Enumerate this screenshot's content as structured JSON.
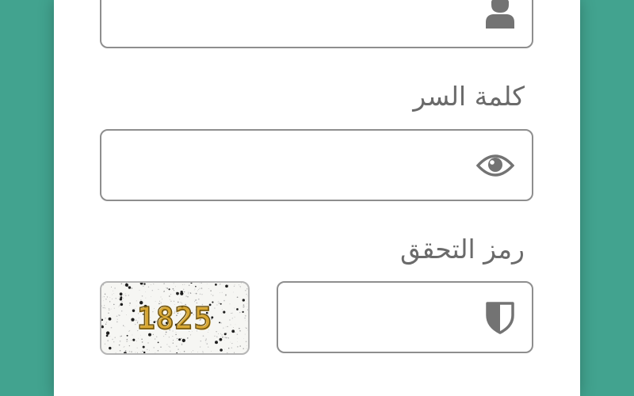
{
  "form": {
    "username": {
      "value": "",
      "icon": "user-icon"
    },
    "password": {
      "label": "كلمة السر",
      "value": "",
      "icon": "eye-icon"
    },
    "captcha": {
      "label": "رمز التحقق",
      "value": "",
      "icon": "shield-icon",
      "image_text": "1825"
    }
  },
  "colors": {
    "background": "#42a38f",
    "card": "#ffffff",
    "field_border": "#8e8e8e",
    "label_text": "#6a6a6a",
    "icon": "#737373"
  }
}
